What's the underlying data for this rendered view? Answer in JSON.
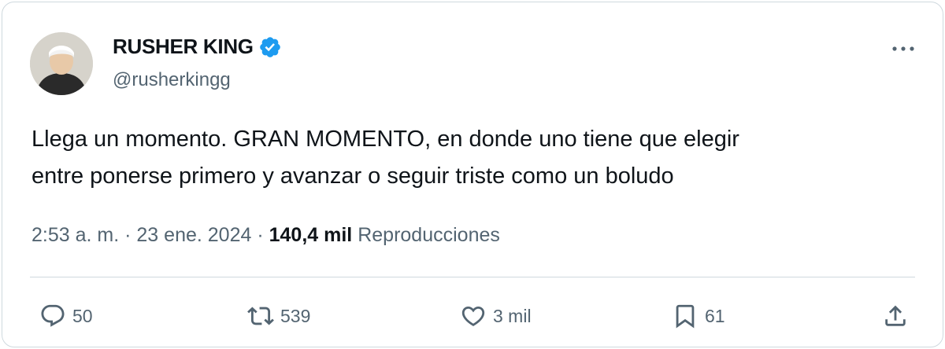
{
  "user": {
    "display_name": "RUSHER KING",
    "handle": "@rusherkingg",
    "verified": true,
    "verified_color": "#1d9bf0"
  },
  "tweet": {
    "text_lines": [
      "Llega un momento. GRAN MOMENTO, en donde uno tiene que elegir",
      "entre ponerse primero y avanzar o seguir triste como un boludo"
    ]
  },
  "meta": {
    "time": "2:53 a. m.",
    "separator": "·",
    "date": "23 ene. 2024",
    "views_count": "140,4 mil",
    "views_label": "Reproducciones"
  },
  "actions": {
    "replies": "50",
    "retweets": "539",
    "likes": "3 mil",
    "bookmarks": "61"
  },
  "icons": {
    "more": "more-horizontal-icon",
    "reply": "reply-icon",
    "retweet": "retweet-icon",
    "like": "heart-icon",
    "bookmark": "bookmark-icon",
    "share": "share-icon"
  }
}
